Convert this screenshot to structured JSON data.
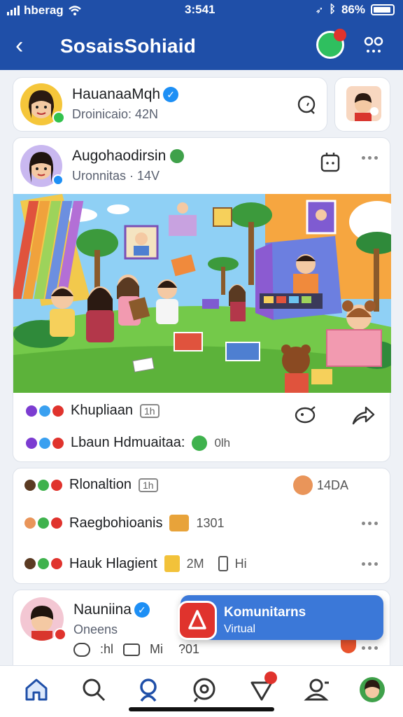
{
  "status_bar": {
    "carrier": "hberag",
    "time": "3:541",
    "battery": "86%"
  },
  "header": {
    "title": "SosaisSohiaid"
  },
  "profile_card": {
    "name": "HauanaaMqh",
    "sub": "Droinicaio: 42N"
  },
  "post": {
    "author": "Augohaodirsin",
    "meta": "Uronnitas · 14V",
    "action_label": "Khupliaan",
    "action_tag": "1h",
    "comment_label": "Lbaun Hdmuaitaa:",
    "comment_count": "0lh"
  },
  "list_card": {
    "rows": [
      {
        "label": "Rlonaltion",
        "tag": "1h",
        "right": "14DA"
      },
      {
        "label": "Raegbohioanis",
        "count": "1301"
      },
      {
        "label": "Hauk Hlagient",
        "count": "2M",
        "extra": "Hi"
      }
    ]
  },
  "bottom_post": {
    "name": "Nauniina",
    "sub": "Oneens",
    "stat1": ":hl",
    "stat2": "Mi",
    "stat3": "?01"
  },
  "notification": {
    "title": "Komunitarns",
    "sub": "Virtual"
  },
  "colors": {
    "header": "#1f4fa8",
    "accent": "#1d8ff5",
    "alert": "#e0332d"
  },
  "icons": [
    "back-icon",
    "chat-icon",
    "more-icon",
    "home-icon",
    "search-icon",
    "people-icon",
    "messenger-icon",
    "notification-icon",
    "profile-icon"
  ]
}
